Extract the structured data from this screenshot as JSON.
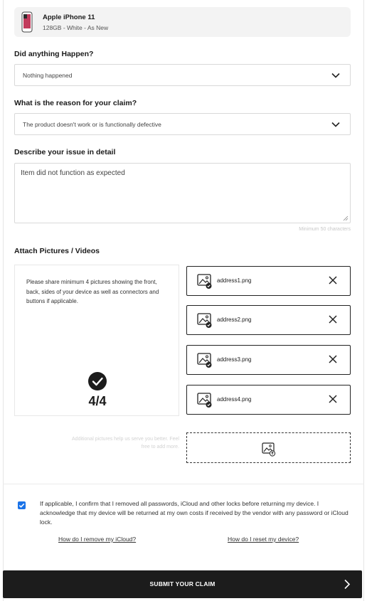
{
  "product": {
    "name": "Apple iPhone 11",
    "details": "128GB - White - As New"
  },
  "incident": {
    "label": "Did anything Happen?",
    "value": "Nothing happened"
  },
  "reason": {
    "label": "What is the reason for your claim?",
    "value": "The product doesn't work or is functionally defective"
  },
  "description": {
    "label": "Describe your issue in detail",
    "value": "Item did not function as expected",
    "hint": "Minimum 50 characters"
  },
  "attachments": {
    "label": "Attach Pictures / Videos",
    "instructions": "Please share minimum 4 pictures showing the front, back, sides of your device as well as connectors and buttons if applicable.",
    "count": "4/4",
    "files": [
      "address1.png",
      "address2.png",
      "address3.png",
      "address4.png"
    ],
    "additional_hint": "Additional pictures help us serve you better. Feel free to add more."
  },
  "consent": {
    "checked": true,
    "text": "If applicable, I confirm that I removed all passwords, iCloud and other locks before returning my device. I acknowledge that my device will be returned at my own costs if received by the vendor with any password or iCloud lock.",
    "link_icloud": "How do I remove my iCloud?",
    "link_reset": "How do I reset my device?"
  },
  "submit_label": "SUBMIT YOUR CLAIM",
  "colors": {
    "accent": "#1a73e8",
    "button": "#1c1c1c"
  }
}
